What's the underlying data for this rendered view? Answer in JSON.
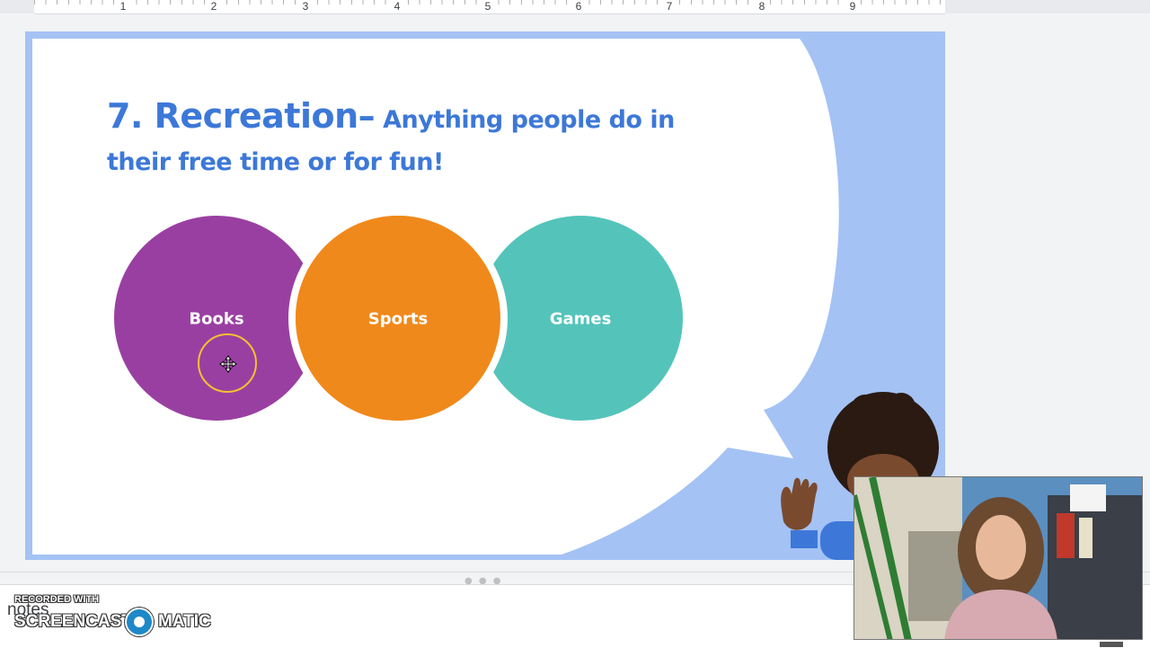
{
  "ruler": {
    "numbers": [
      "1",
      "2",
      "3",
      "4",
      "5",
      "6",
      "7",
      "8",
      "9"
    ]
  },
  "slide": {
    "title_main": "7. Recreation–",
    "title_sub": " Anything people do in their free time or for fun!",
    "circles": [
      {
        "label": "Books",
        "color": "#9a3fa2"
      },
      {
        "label": "Sports",
        "color": "#f0891b"
      },
      {
        "label": "Games",
        "color": "#54c4bb"
      }
    ],
    "accent_color": "#a4c2f4",
    "title_color": "#3d78d8",
    "cursor_icon": "move-cursor-icon"
  },
  "notes": {
    "text": "notes"
  },
  "watermark": {
    "small": "RECORDED WITH",
    "left": "SCREENCAST",
    "right": "MATIC"
  },
  "webcam": {
    "description_icon": "webcam-video"
  }
}
